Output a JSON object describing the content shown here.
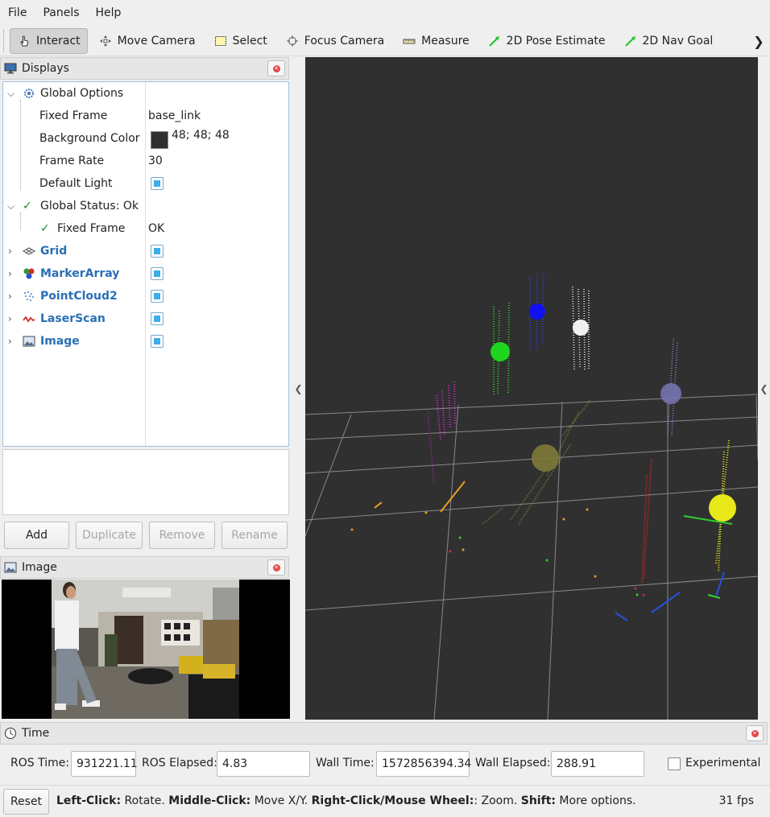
{
  "menu": {
    "file": "File",
    "panels": "Panels",
    "help": "Help"
  },
  "toolbar": {
    "interact": "Interact",
    "move_camera": "Move Camera",
    "select": "Select",
    "focus_camera": "Focus Camera",
    "measure": "Measure",
    "pose_estimate": "2D Pose Estimate",
    "nav_goal": "2D Nav Goal"
  },
  "displays": {
    "title": "Displays",
    "global_options": "Global Options",
    "fixed_frame_label": "Fixed Frame",
    "fixed_frame_value": "base_link",
    "bg_color_label": "Background Color",
    "bg_color_value": "48; 48; 48",
    "frame_rate_label": "Frame Rate",
    "frame_rate_value": "30",
    "default_light_label": "Default Light",
    "global_status": "Global Status: Ok",
    "status_fixed_frame": "Fixed Frame",
    "status_fixed_frame_value": "OK",
    "items": [
      "Grid",
      "MarkerArray",
      "PointCloud2",
      "LaserScan",
      "Image"
    ]
  },
  "buttons": {
    "add": "Add",
    "duplicate": "Duplicate",
    "remove": "Remove",
    "rename": "Rename"
  },
  "image_panel": {
    "title": "Image"
  },
  "time": {
    "title": "Time",
    "ros_time_label": "ROS Time:",
    "ros_time": "931221.11",
    "ros_elapsed_label": "ROS Elapsed:",
    "ros_elapsed": "4.83",
    "wall_time_label": "Wall Time:",
    "wall_time": "1572856394.34",
    "wall_elapsed_label": "Wall Elapsed:",
    "wall_elapsed": "288.91",
    "experimental": "Experimental"
  },
  "status": {
    "reset": "Reset",
    "left_click": "Left-Click:",
    "left_click_desc": " Rotate. ",
    "middle_click": "Middle-Click:",
    "middle_click_desc": " Move X/Y. ",
    "right_click": "Right-Click/Mouse Wheel:",
    "right_click_desc": ": Zoom. ",
    "shift": "Shift:",
    "shift_desc": " More options.",
    "fps": "31 fps"
  },
  "colors": {
    "background": "#303030",
    "accent": "#3daee9",
    "link": "#2a6fb5"
  }
}
